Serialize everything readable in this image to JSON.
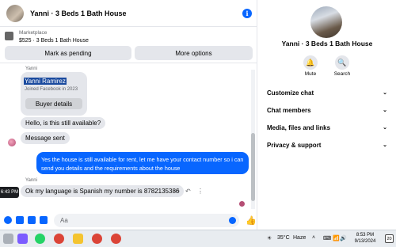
{
  "header": {
    "title": "Yanni · 3 Beds 1 Bath House",
    "info_icon": "i"
  },
  "marketplace": {
    "label": "Marketplace",
    "listing": "$525 · 3 Beds 1 Bath House",
    "pending_label": "Mark as pending",
    "more_label": "More options"
  },
  "messages": {
    "sender_name_top": "Yanni",
    "card": {
      "name": "Yanni Ramirez",
      "joined": "Joined Facebook in 2023",
      "details_label": "Buyer details"
    },
    "m1": "Hello, is this still available?",
    "m2": "Message sent",
    "m3": "Yes the house is still available for rent, let me have your contact number so i can send you details and the requirements about the house",
    "sender_name_bottom": "Yanni",
    "m4": "Ok my language is Spanish my number is 8782135386",
    "tooltip": "6:43 PM"
  },
  "composer": {
    "placeholder": "Aa"
  },
  "panel": {
    "title": "Yanni · 3 Beds 1 Bath House",
    "mute_label": "Mute",
    "search_label": "Search",
    "rows": [
      "Customize chat",
      "Chat members",
      "Media, files and links",
      "Privacy & support"
    ]
  },
  "taskbar": {
    "weather": "35°C",
    "condition": "Haze",
    "time": "8:53 PM",
    "date": "9/13/2024",
    "notifications": "20"
  },
  "colors": {
    "accent": "#0866ff",
    "bubble": "#e4e6eb"
  }
}
